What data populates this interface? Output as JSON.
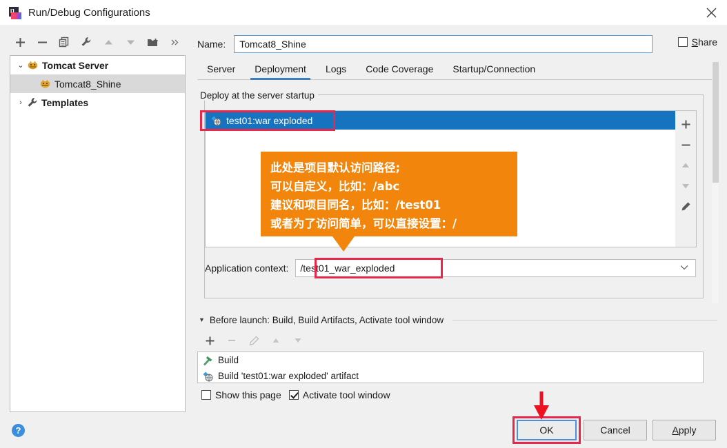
{
  "window": {
    "title": "Run/Debug Configurations",
    "close_icon": "close-icon",
    "app_icon": "intellij-idea-icon",
    "logo_text": "IJ"
  },
  "left_toolbar": {
    "buttons": [
      {
        "name": "add-configuration-button",
        "icon": "plus-icon",
        "label": "+"
      },
      {
        "name": "remove-configuration-button",
        "icon": "minus-icon",
        "label": "−"
      },
      {
        "name": "copy-configuration-button",
        "icon": "copy-icon",
        "label": "Copy"
      },
      {
        "name": "edit-templates-button",
        "icon": "wrench-icon",
        "label": "Edit Templates"
      },
      {
        "name": "move-up-button",
        "icon": "arrow-up-icon",
        "label": "Move Up"
      },
      {
        "name": "move-down-button",
        "icon": "arrow-down-icon",
        "label": "Move Down"
      },
      {
        "name": "new-folder-button",
        "icon": "folder-add-icon",
        "label": "New Folder"
      },
      {
        "name": "more-options-button",
        "icon": "chevron-double-right-icon",
        "label": "»"
      }
    ]
  },
  "sidebar": {
    "items": [
      {
        "label": "Tomcat Server",
        "icon": "tomcat-cat-icon",
        "twisty": "⌄",
        "expanded": true,
        "bold": true,
        "selected": false,
        "indent": 0
      },
      {
        "label": "Tomcat8_Shine",
        "icon": "tomcat-cat-icon",
        "twisty": "",
        "expanded": false,
        "bold": false,
        "selected": true,
        "indent": 1
      },
      {
        "label": "Templates",
        "icon": "wrench-icon",
        "twisty": "›",
        "expanded": false,
        "bold": true,
        "selected": false,
        "indent": 0
      }
    ]
  },
  "name_field": {
    "label": "Name:",
    "value": "Tomcat8_Shine",
    "placeholder": "Name"
  },
  "share": {
    "label_prefix": "",
    "label": "Share",
    "mnemonic": "S",
    "rest": "hare",
    "checked": false
  },
  "tabs": [
    {
      "label": "Server",
      "active": false
    },
    {
      "label": "Deployment",
      "active": true
    },
    {
      "label": "Logs",
      "active": false
    },
    {
      "label": "Code Coverage",
      "active": false
    },
    {
      "label": "Startup/Connection",
      "active": false
    }
  ],
  "deployment": {
    "group_title": "Deploy at the server startup",
    "items": [
      {
        "label": "test01:war exploded",
        "icon": "artifact-icon",
        "selected": true
      }
    ],
    "side_buttons": [
      {
        "name": "add-artifact-button",
        "icon": "plus-icon",
        "label": "+"
      },
      {
        "name": "remove-artifact-button",
        "icon": "minus-icon",
        "label": "−"
      },
      {
        "name": "move-artifact-up-button",
        "icon": "arrow-up-icon",
        "label": "Up"
      },
      {
        "name": "move-artifact-down-button",
        "icon": "arrow-down-icon",
        "label": "Down"
      },
      {
        "name": "edit-artifact-button",
        "icon": "pencil-icon",
        "label": "Edit"
      }
    ],
    "application_context": {
      "label": "Application context:",
      "value": "/test01_war_exploded",
      "dropdown_icon": "chevron-down-icon"
    }
  },
  "before_launch": {
    "triangle": "▼",
    "title": "Before launch: Build, Build Artifacts, Activate tool window",
    "toolbar": [
      {
        "name": "before-launch-add-button",
        "icon": "plus-icon",
        "label": "+",
        "disabled": false
      },
      {
        "name": "before-launch-remove-button",
        "icon": "minus-icon",
        "label": "−",
        "disabled": true
      },
      {
        "name": "before-launch-edit-button",
        "icon": "pencil-icon",
        "label": "Edit",
        "disabled": true
      },
      {
        "name": "before-launch-move-up-button",
        "icon": "arrow-up-icon",
        "label": "Up",
        "disabled": true
      },
      {
        "name": "before-launch-move-down-button",
        "icon": "arrow-down-icon",
        "label": "Down",
        "disabled": true
      }
    ],
    "items": [
      {
        "label": "Build",
        "icon": "hammer-icon"
      },
      {
        "label": "Build 'test01:war exploded' artifact",
        "icon": "artifact-icon"
      }
    ],
    "show_this_page": {
      "label": "Show this page",
      "checked": false
    },
    "activate_tool_window": {
      "label": "Activate tool window",
      "checked": true
    }
  },
  "footer": {
    "help_icon": "help-icon",
    "help_label": "?",
    "buttons": [
      {
        "name": "ok-button",
        "label": "OK",
        "mnemonic": "",
        "focused": true
      },
      {
        "name": "cancel-button",
        "label": "Cancel",
        "mnemonic": "",
        "focused": false
      },
      {
        "name": "apply-button",
        "label": "Apply",
        "mnemonic": "A",
        "focused": false
      }
    ],
    "apply_mnemonic_head": "A",
    "apply_rest": "pply"
  },
  "annotations": {
    "callout_color": "#f2860d",
    "highlight_color": "#e8284a",
    "arrow_color": "#ee1122",
    "callout_lines": [
      "此处是项目默认访问路径;",
      "可以自定义，比如：/abc",
      "建议和项目同名，比如：/test01",
      "或者为了访问简单，可以直接设置：/"
    ]
  }
}
